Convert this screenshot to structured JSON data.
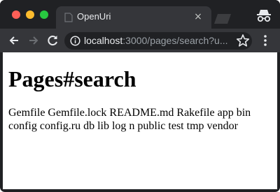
{
  "window": {
    "tab_title": "OpenUri",
    "tab_close": "×"
  },
  "toolbar": {
    "url_host": "localhost",
    "url_rest": ":3000/pages/search?u..."
  },
  "page": {
    "title": "Pages#search",
    "content": "Gemfile Gemfile.lock README.md Rakefile app bin config config.ru db lib log n public test tmp vendor"
  },
  "icons": {
    "back": "back-arrow-icon",
    "forward": "forward-arrow-icon",
    "reload": "reload-icon",
    "info": "info-icon",
    "star": "bookmark-star-icon",
    "menu": "menu-icon",
    "incognito": "incognito-icon",
    "favicon": "page-favicon-icon"
  },
  "colors": {
    "frame": "#202124",
    "toolbar": "#35363a",
    "traffic_red": "#fe5f57",
    "traffic_yellow": "#febc2e",
    "traffic_green": "#28c840"
  }
}
